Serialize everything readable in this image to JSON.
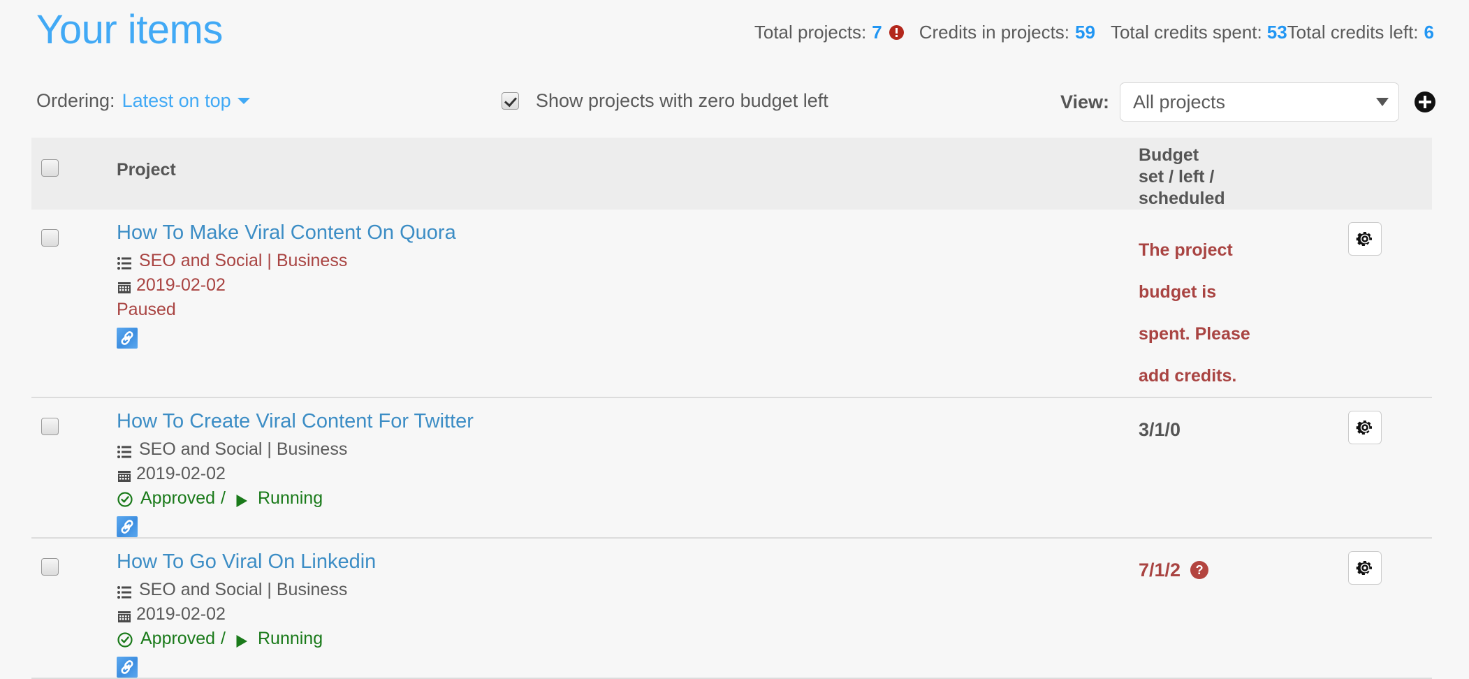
{
  "header": {
    "title": "Your items",
    "stats": [
      {
        "label": "Total projects:",
        "value": "7",
        "alert": true
      },
      {
        "label": "Credits in projects:",
        "value": "59",
        "alert": false
      },
      {
        "label": "Total credits spent:",
        "value": "53",
        "alert": false
      },
      {
        "label": "Total credits left:",
        "value": "6",
        "alert": false
      }
    ]
  },
  "controls": {
    "ordering_label": "Ordering:",
    "ordering_value": "Latest on top",
    "zero_budget_label": "Show projects with zero budget left",
    "zero_budget_checked": true,
    "view_label": "View:",
    "view_value": "All projects",
    "add_button_label": "+"
  },
  "table": {
    "headers": {
      "project": "Project",
      "budget_line1": "Budget",
      "budget_line2": "set / left /",
      "budget_line3": "scheduled"
    },
    "rows": [
      {
        "title": "How To Make Viral Content On Quora",
        "category": "SEO and Social | Business",
        "date": "2019-02-02",
        "status_text": "Paused",
        "status_type": "paused",
        "tone": "danger",
        "budget_value": "",
        "budget_message": "The project budget is spent. Please add credits.",
        "budget_help": false
      },
      {
        "title": "How To Create Viral Content For Twitter",
        "category": "SEO and Social | Business",
        "date": "2019-02-02",
        "status_approved": "Approved",
        "status_separator": "/",
        "status_running": "Running",
        "status_type": "running",
        "tone": "normal",
        "budget_value": "3/1/0",
        "budget_message": "",
        "budget_help": false
      },
      {
        "title": "How To Go Viral On Linkedin",
        "category": "SEO and Social | Business",
        "date": "2019-02-02",
        "status_approved": "Approved",
        "status_separator": "/",
        "status_running": "Running",
        "status_type": "running",
        "tone": "normal",
        "budget_value": "7/1/2",
        "budget_message": "",
        "budget_help": true,
        "budget_help_glyph": "?"
      }
    ]
  },
  "colors": {
    "title_blue": "#41a9f5",
    "link_blue": "#3c8dc5",
    "stat_blue": "#2196f3",
    "danger_red": "#a94442",
    "success_green": "#1a7a1a",
    "header_band": "#ededed",
    "page_bg": "#f7f7f7"
  }
}
